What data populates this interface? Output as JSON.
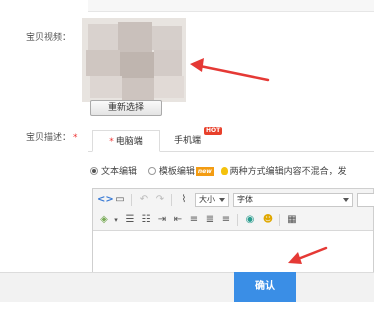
{
  "form": {
    "video_label": "宝贝视频：",
    "reselect_button": "重新选择",
    "desc_label": "宝贝描述：",
    "desc_required": "*"
  },
  "tabs": {
    "pc_star": "*",
    "pc_label": "电脑端",
    "mobile_label": "手机端",
    "hot_badge": "HOT"
  },
  "mode": {
    "text_edit": "文本编辑",
    "template_edit": "模板编辑",
    "new_badge": "new",
    "hint": "两种方式编辑内容不混合，发"
  },
  "toolbar": {
    "size_select": "大小",
    "font_select": "字体"
  },
  "footer": {
    "confirm_button": "确认"
  },
  "colors": {
    "accent": "#3a8ee6",
    "arrow": "#e53935"
  }
}
